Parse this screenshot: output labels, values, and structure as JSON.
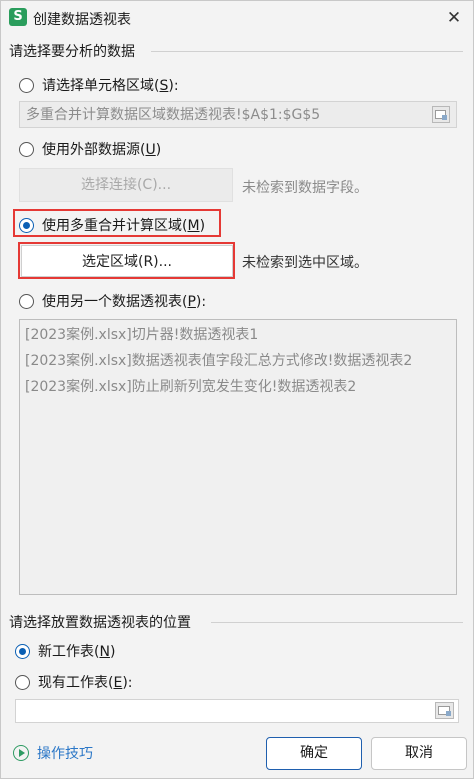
{
  "window": {
    "title": "创建数据透视表",
    "app_icon_glyph": "S",
    "close_glyph": "✕"
  },
  "source_section": {
    "title": "请选择要分析的数据",
    "option_range": {
      "label": "请选择单元格区域(",
      "key": "S",
      "suffix": "):",
      "checked": false
    },
    "range_value": "多重合并计算数据区域数据透视表!$A$1:$G$5",
    "option_external": {
      "label": "使用外部数据源(",
      "key": "U",
      "suffix": ")",
      "checked": false
    },
    "choose_connection_button": "选择连接(C)...",
    "external_status": "未检索到数据字段。",
    "option_consolidation": {
      "label": "使用多重合并计算区域(",
      "key": "M",
      "suffix": ")",
      "checked": true
    },
    "select_region_button": "选定区域(R)...",
    "region_status": "未检索到选中区域。",
    "option_other_pivot": {
      "label": "使用另一个数据透视表(",
      "key": "P",
      "suffix": "):",
      "checked": false
    },
    "pivot_items": [
      "[2023案例.xlsx]切片器!数据透视表1",
      "[2023案例.xlsx]数据透视表值字段汇总方式修改!数据透视表2",
      "[2023案例.xlsx]防止刷新列宽发生变化!数据透视表2"
    ]
  },
  "placement_section": {
    "title": "请选择放置数据透视表的位置",
    "option_new_sheet": {
      "label": "新工作表(",
      "key": "N",
      "suffix": ")",
      "checked": true
    },
    "option_existing_sheet": {
      "label": "现有工作表(",
      "key": "E",
      "suffix": "):",
      "checked": false
    },
    "position_value": ""
  },
  "footer": {
    "tips_label": "操作技巧",
    "ok_label": "确定",
    "cancel_label": "取消"
  },
  "colors": {
    "accent": "#0a5fb4",
    "highlight": "#e53935",
    "link": "#2b77c7"
  },
  "icons": {
    "app": "wps-spreadsheet-icon",
    "close": "close-icon",
    "range_picker": "range-picker-icon",
    "tips": "play-circle-icon"
  }
}
